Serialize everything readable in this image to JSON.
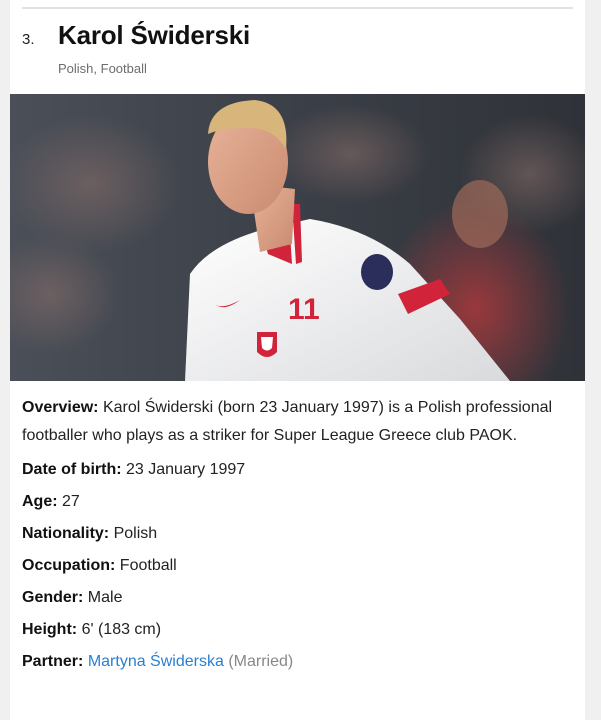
{
  "profile": {
    "rank": "3.",
    "name": "Karol Świderski",
    "tags": "Polish, Football",
    "photo_alt": "Karol Świderski",
    "overview_label": "Overview:",
    "overview_text": "Karol Świderski (born 23 January 1997) is a Polish professional footballer who plays as a striker for Super League Greece club PAOK.",
    "facts": {
      "dob_label": "Date of birth:",
      "dob_value": "23 January 1997",
      "age_label": "Age:",
      "age_value": "27",
      "nationality_label": "Nationality:",
      "nationality_value": "Polish",
      "occupation_label": "Occupation:",
      "occupation_value": "Football",
      "gender_label": "Gender:",
      "gender_value": "Male",
      "height_label": "Height:",
      "height_value": "6' (183 cm)",
      "partner_label": "Partner:",
      "partner_name": "Martyna Świderska",
      "partner_status": "(Married)"
    },
    "jersey_number": "11"
  },
  "colors": {
    "link": "#2a7fd4",
    "kit_red": "#d1233a"
  }
}
